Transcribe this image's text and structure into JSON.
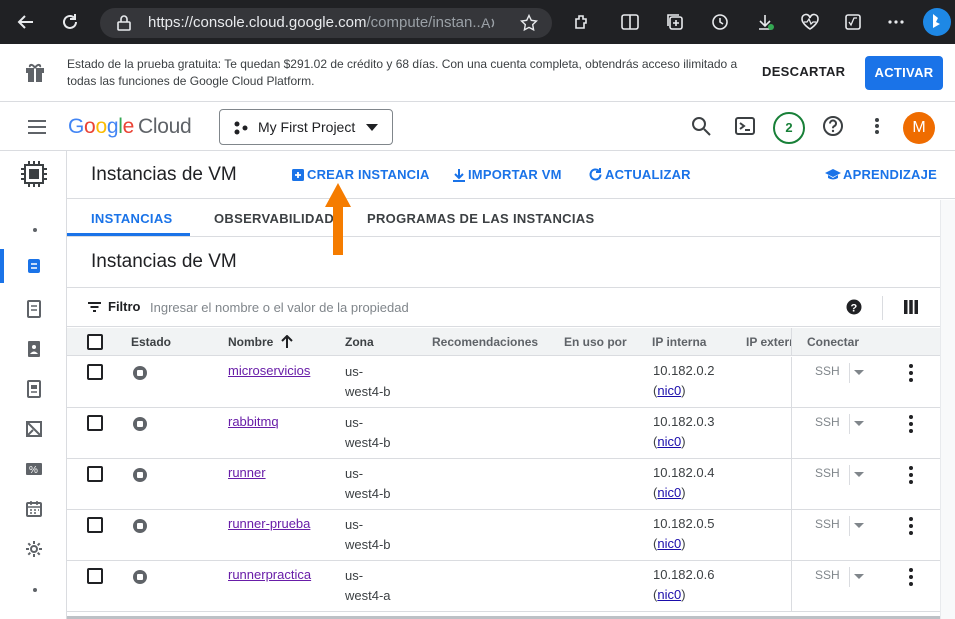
{
  "browser": {
    "url_main": "https://console.cloud.google.com",
    "url_rest": "/compute/instan..."
  },
  "banner": {
    "message": "Estado de la prueba gratuita: Te quedan $291.02 de crédito y 68 días. Con una cuenta completa, obtendrás acceso ilimitado a todas las funciones de Google Cloud Platform.",
    "dismiss": "DESCARTAR",
    "activate": "ACTIVAR"
  },
  "header": {
    "logo_google": "Google",
    "logo_cloud": "Cloud",
    "project": "My First Project",
    "notifications": "2",
    "avatar": "M"
  },
  "toolbar": {
    "title": "Instancias de VM",
    "create": "CREAR INSTANCIA",
    "import": "IMPORTAR VM",
    "refresh": "ACTUALIZAR",
    "learn": "APRENDIZAJE"
  },
  "tabs": [
    "INSTANCIAS",
    "OBSERVABILIDAD",
    "PROGRAMAS DE LAS INSTANCIAS"
  ],
  "section_title": "Instancias de VM",
  "filter": {
    "label": "Filtro",
    "placeholder": "Ingresar el nombre o el valor de la propiedad"
  },
  "table": {
    "headers": {
      "status": "Estado",
      "name": "Nombre",
      "zone": "Zona",
      "recommendations": "Recomendaciones",
      "in_use_by": "En uso por",
      "internal_ip": "IP interna",
      "external_ip": "IP extern",
      "connect": "Conectar"
    },
    "rows": [
      {
        "name": "microservicios",
        "zone_1": "us-",
        "zone_2": "west4-b",
        "ip": "10.182.0.2",
        "nic": "nic0",
        "connect": "SSH"
      },
      {
        "name": "rabbitmq",
        "zone_1": "us-",
        "zone_2": "west4-b",
        "ip": "10.182.0.3",
        "nic": "nic0",
        "connect": "SSH"
      },
      {
        "name": "runner",
        "zone_1": "us-",
        "zone_2": "west4-b",
        "ip": "10.182.0.4",
        "nic": "nic0",
        "connect": "SSH"
      },
      {
        "name": "runner-prueba",
        "zone_1": "us-",
        "zone_2": "west4-b",
        "ip": "10.182.0.5",
        "nic": "nic0",
        "connect": "SSH"
      },
      {
        "name": "runnerpractica",
        "zone_1": "us-",
        "zone_2": "west4-a",
        "ip": "10.182.0.6",
        "nic": "nic0",
        "connect": "SSH"
      }
    ]
  },
  "colors": {
    "accent": "#1a73e8",
    "annotation_arrow": "#f57c00",
    "visited_link": "#681da8"
  }
}
